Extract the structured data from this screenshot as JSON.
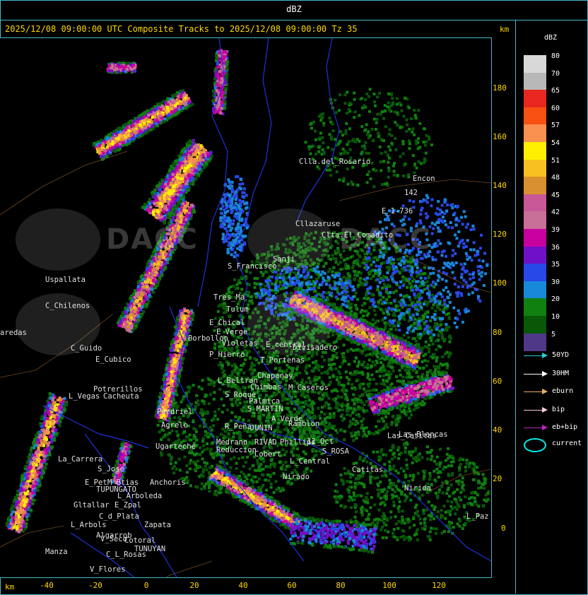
{
  "header": {
    "title": "dBZ",
    "subtitle": "2025/12/08 09:00:00 UTC Composite Tracks to 2025/12/08 09:00:00 Tz 35",
    "km_top": "km",
    "km_bottom": "km"
  },
  "axes": {
    "y_ticks": [
      "180",
      "160",
      "140",
      "120",
      "100",
      "80",
      "60",
      "40",
      "20",
      "0"
    ],
    "x_ticks": [
      "-40",
      "-20",
      "0",
      "20",
      "40",
      "60",
      "80",
      "100",
      "120"
    ]
  },
  "legend": {
    "title": "dBZ",
    "levels": [
      {
        "label": "80",
        "color": "#d8d8d8"
      },
      {
        "label": "70",
        "color": "#b8b8b8"
      },
      {
        "label": "65",
        "color": "#e82820"
      },
      {
        "label": "60",
        "color": "#f85010"
      },
      {
        "label": "57",
        "color": "#f89050"
      },
      {
        "label": "54",
        "color": "#fff000"
      },
      {
        "label": "51",
        "color": "#f8c020"
      },
      {
        "label": "48",
        "color": "#d89030"
      },
      {
        "label": "45",
        "color": "#c85898"
      },
      {
        "label": "42",
        "color": "#c87098"
      },
      {
        "label": "39",
        "color": "#c800a0"
      },
      {
        "label": "36",
        "color": "#7010c8"
      },
      {
        "label": "35",
        "color": "#2848e8"
      },
      {
        "label": "30",
        "color": "#1888d8"
      },
      {
        "label": "20",
        "color": "#108010"
      },
      {
        "label": "10",
        "color": "#085808"
      },
      {
        "label": "5",
        "color": "#503888"
      }
    ],
    "tracks": [
      {
        "label": "50YD",
        "color": "#20d0d8"
      },
      {
        "label": "30HM",
        "color": "#ffffff"
      },
      {
        "label": "eburn",
        "color": "#e8b060"
      },
      {
        "label": "bip",
        "color": "#f8c8d8"
      },
      {
        "label": "eb+bip",
        "color": "#c020c0"
      }
    ],
    "current_label": "current"
  },
  "places": [
    {
      "name": "Clla.del_Rosario"
    },
    {
      "name": "Encon"
    },
    {
      "name": "142"
    },
    {
      "name": "E_1-736"
    },
    {
      "name": "Cllazaruse"
    },
    {
      "name": "Clta.El_Comadito"
    },
    {
      "name": "Uspallata"
    },
    {
      "name": "C_Chilenos"
    },
    {
      "name": "aredas"
    },
    {
      "name": "C_Guido"
    },
    {
      "name": "E_Cubico"
    },
    {
      "name": "S_Francisco"
    },
    {
      "name": "Sanji"
    },
    {
      "name": "Tres_Ma"
    },
    {
      "name": "Tulum"
    },
    {
      "name": "E_Chical"
    },
    {
      "name": "E_Verge"
    },
    {
      "name": "Borbollon"
    },
    {
      "name": "Violetas"
    },
    {
      "name": "P_Hierro"
    },
    {
      "name": "E_central"
    },
    {
      "name": "Divisadero"
    },
    {
      "name": "T_Portenas"
    },
    {
      "name": "Chapanay"
    },
    {
      "name": "L_Beltran"
    },
    {
      "name": "Chimbas"
    },
    {
      "name": "M_Caseros"
    },
    {
      "name": "Potrerillos"
    },
    {
      "name": "L_Vegas"
    },
    {
      "name": "Cacheuta"
    },
    {
      "name": "S_Roque"
    },
    {
      "name": "Palmica"
    },
    {
      "name": "S_MARTIN"
    },
    {
      "name": "Perdriel"
    },
    {
      "name": "A_Verde"
    },
    {
      "name": "Ramblon"
    },
    {
      "name": "Agrelo"
    },
    {
      "name": "R_Peña"
    },
    {
      "name": "JUNIN"
    },
    {
      "name": "Ugarteche"
    },
    {
      "name": "Medrano"
    },
    {
      "name": "RIVAD"
    },
    {
      "name": "Phillips"
    },
    {
      "name": "12_Oct"
    },
    {
      "name": "Reduccion"
    },
    {
      "name": "Cobert"
    },
    {
      "name": "L_Central"
    },
    {
      "name": "Las_Catitas"
    },
    {
      "name": "La_Carrera"
    },
    {
      "name": "S_Jose"
    },
    {
      "name": "E_Pet"
    },
    {
      "name": "M_Btias"
    },
    {
      "name": "Anchoris"
    },
    {
      "name": "TUPUNGATO"
    },
    {
      "name": "L_Arboleda"
    },
    {
      "name": "Nirado"
    },
    {
      "name": "S_ROSA"
    },
    {
      "name": "Gltallar"
    },
    {
      "name": "E_Zpal"
    },
    {
      "name": "C_d_Plata"
    },
    {
      "name": "Zapata"
    },
    {
      "name": "L_Arbols"
    },
    {
      "name": "Algarrob"
    },
    {
      "name": "V_Seco"
    },
    {
      "name": "Cotoral"
    },
    {
      "name": "TUNUYAN"
    },
    {
      "name": "Manza"
    },
    {
      "name": "C_L_Rosas"
    },
    {
      "name": "V_Flores"
    },
    {
      "name": "Catitas"
    },
    {
      "name": "Nirida"
    },
    {
      "name": "L_Paz"
    },
    {
      "name": "Las_Blancas"
    }
  ],
  "watermarks": [
    "DACC",
    "DACC"
  ]
}
